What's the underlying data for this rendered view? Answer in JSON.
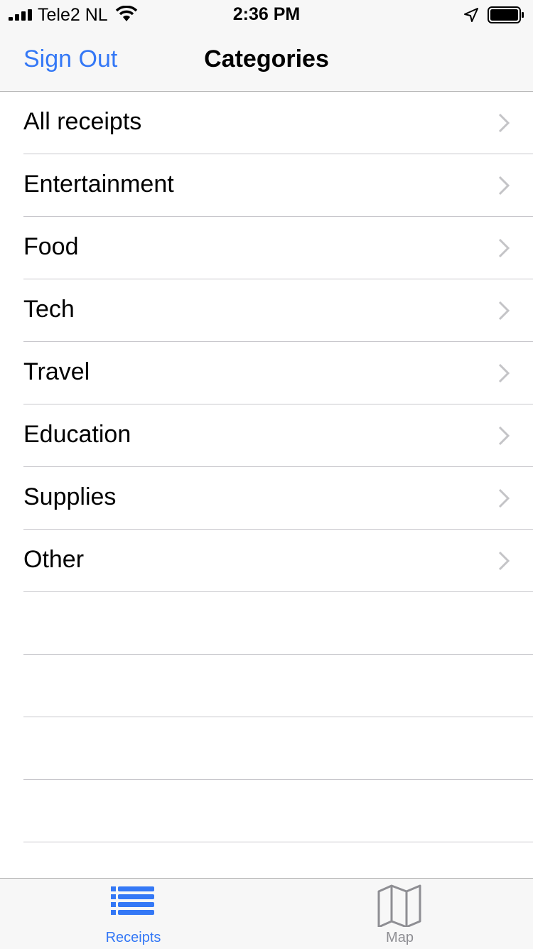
{
  "status_bar": {
    "carrier": "Tele2 NL",
    "time": "2:36 PM"
  },
  "nav": {
    "left_button": "Sign Out",
    "title": "Categories"
  },
  "categories": [
    {
      "label": "All receipts"
    },
    {
      "label": "Entertainment"
    },
    {
      "label": "Food"
    },
    {
      "label": "Tech"
    },
    {
      "label": "Travel"
    },
    {
      "label": "Education"
    },
    {
      "label": "Supplies"
    },
    {
      "label": "Other"
    }
  ],
  "tab_bar": {
    "tabs": [
      {
        "label": "Receipts",
        "icon": "list-icon",
        "selected": true
      },
      {
        "label": "Map",
        "icon": "map-icon",
        "selected": false
      }
    ]
  },
  "colors": {
    "accent": "#3478f6",
    "inactive": "#8e8e93",
    "separator": "#c8c7cc",
    "bar_background": "#f7f7f7"
  }
}
